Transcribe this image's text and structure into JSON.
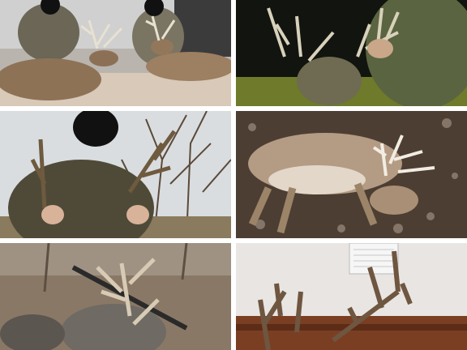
{
  "gallery": {
    "tiles": [
      {
        "subject": "two-hunters-two-bucks-indoor"
      },
      {
        "subject": "hunter-holding-antlers-night"
      },
      {
        "subject": "masked-hunter-holding-antlers-woods"
      },
      {
        "subject": "buck-lying-on-leaves"
      },
      {
        "subject": "buck-with-rifle-on-ground"
      },
      {
        "subject": "mounted-antlers-on-wall"
      }
    ]
  }
}
